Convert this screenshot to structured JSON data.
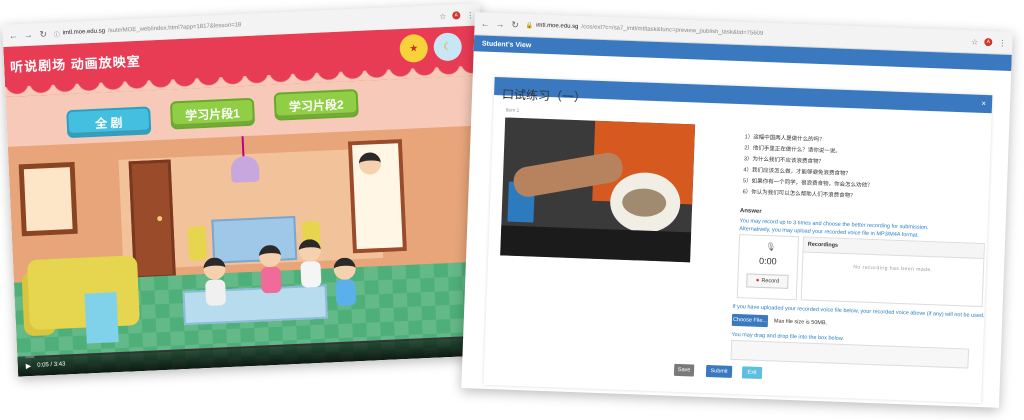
{
  "left_window": {
    "url_host": "imtl.moe.edu.sg",
    "url_path": "/sute/MOE_web/index.html?app=1817&lesson=18",
    "game_title": "听说剧场  动画放映室",
    "buttons": {
      "full": "全  剧",
      "segment1": "学习片段1",
      "segment2": "学习片段2"
    },
    "video": {
      "time": "0:05 / 3:43",
      "progress_fraction": 0.02
    }
  },
  "right_window": {
    "url_host": "imtl.moe.edu.sg",
    "url_path": "/cos/ext?c=/sa7_imtl/mtltask&func=preview_publish_task&tid=75609",
    "header_label": "Student's View",
    "page_title": "口试练习（一）",
    "item_label": "Item 1",
    "questions": [
      "1）这幅中国两人是做什么的吗？",
      "2）他们手里正在做什么？请你说一说。",
      "3）为什么我们不应该浪费食物？",
      "4）我们应该怎么做，才能够避免浪费食物？",
      "5）如果你有一个同学，很浪费食物，你会怎么劝他？",
      "6）你认为我们可以怎么帮助人们不浪费食物？"
    ],
    "answer": {
      "label": "Answer",
      "note_line1": "You may record up to 3 times and choose the better recording for submission.",
      "note_line2": "Alternatively, you may upload your recorded voice file in MP3/M4A format."
    },
    "recorder": {
      "time": "0:00",
      "record_label": "Record"
    },
    "recordings": {
      "header": "Recordings",
      "empty_text": "No recording has been made."
    },
    "upload": {
      "note": "If you have uploaded your recorded voice file below, your recorded voice above (if any) will not be used.",
      "choose_label": "Choose File...",
      "max_size": "Max file size is 50MB.",
      "drag_note": "You may drag and drop file into the box below."
    },
    "actions": {
      "save": "Save",
      "submit": "Submit",
      "exit": "Exit"
    }
  },
  "colors": {
    "game_red": "#e83c54",
    "primary_blue": "#3a79bf",
    "info_blue": "#5bc0de",
    "link_blue": "#2a7fc4"
  }
}
